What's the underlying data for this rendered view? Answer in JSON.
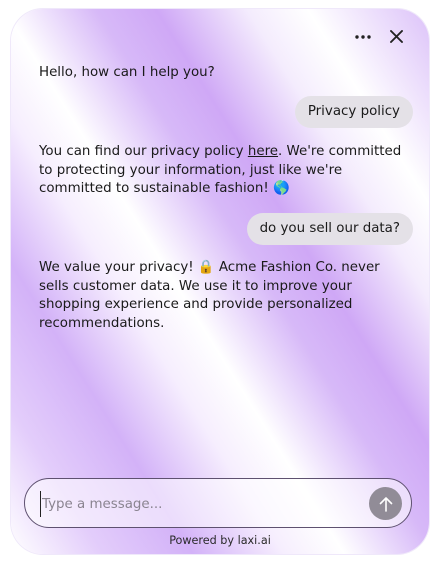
{
  "header": {
    "menu_icon": "more-horizontal-icon",
    "close_icon": "close-icon"
  },
  "messages": [
    {
      "role": "bot",
      "text": "Hello, how can I help you?"
    },
    {
      "role": "user",
      "text": "Privacy policy"
    },
    {
      "role": "bot",
      "before_link": "You can find our privacy policy ",
      "link_text": "here",
      "after_link": ".  We're committed to protecting your information, just like we're committed to sustainable fashion! 🌎"
    },
    {
      "role": "user",
      "text": "do you sell our data?"
    },
    {
      "role": "bot",
      "text": "We value your privacy! 🔒  Acme Fashion Co. never sells customer data. We use it to improve your shopping experience and provide personalized recommendations."
    }
  ],
  "composer": {
    "placeholder": "Type a message...",
    "value": "",
    "send_icon": "arrow-up-icon"
  },
  "footer": {
    "powered_by": "Powered by laxi.ai"
  },
  "colors": {
    "user_bubble": "#e4e1e7",
    "send_button": "#918c97",
    "composer_border": "#5e5170",
    "gradient_purple": "#d3b2f8"
  }
}
